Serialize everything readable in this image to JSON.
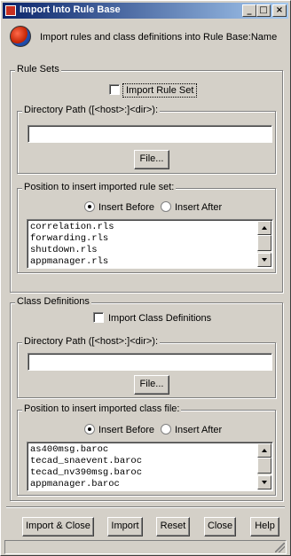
{
  "window": {
    "title": "Import Into Rule Base",
    "controls": {
      "minimize": "_",
      "maximize": "□",
      "close": "×"
    }
  },
  "header": {
    "icon": "globe-icon",
    "text": "Import rules and class definitions into Rule Base:Name"
  },
  "rule_sets": {
    "legend": "Rule Sets",
    "checkbox_label": "Import Rule Set",
    "checked": false,
    "directory": {
      "legend": "Directory Path ([<host>:]<dir>):",
      "value": "",
      "file_button": "File..."
    },
    "position": {
      "legend": "Position to insert imported rule set:",
      "option_before": "Insert Before",
      "option_after": "Insert After",
      "selected": "Insert Before",
      "items": [
        "correlation.rls",
        "forwarding.rls",
        "shutdown.rls",
        "appmanager.rls"
      ]
    }
  },
  "class_definitions": {
    "legend": "Class Definitions",
    "checkbox_label": "Import Class Definitions",
    "checked": false,
    "directory": {
      "legend": "Directory Path ([<host>:]<dir>):",
      "value": "",
      "file_button": "File..."
    },
    "position": {
      "legend": "Position to insert imported class file:",
      "option_before": "Insert Before",
      "option_after": "Insert After",
      "selected": "Insert Before",
      "items": [
        "as400msg.baroc",
        "tecad_snaevent.baroc",
        "tecad_nv390msg.baroc",
        "appmanager.baroc"
      ]
    }
  },
  "buttons": {
    "import_close": "Import & Close",
    "import": "Import",
    "reset": "Reset",
    "close": "Close",
    "help": "Help"
  },
  "colors": {
    "titlebar_start": "#0a246a",
    "titlebar_end": "#a6caf0",
    "face": "#d4d0c8"
  }
}
